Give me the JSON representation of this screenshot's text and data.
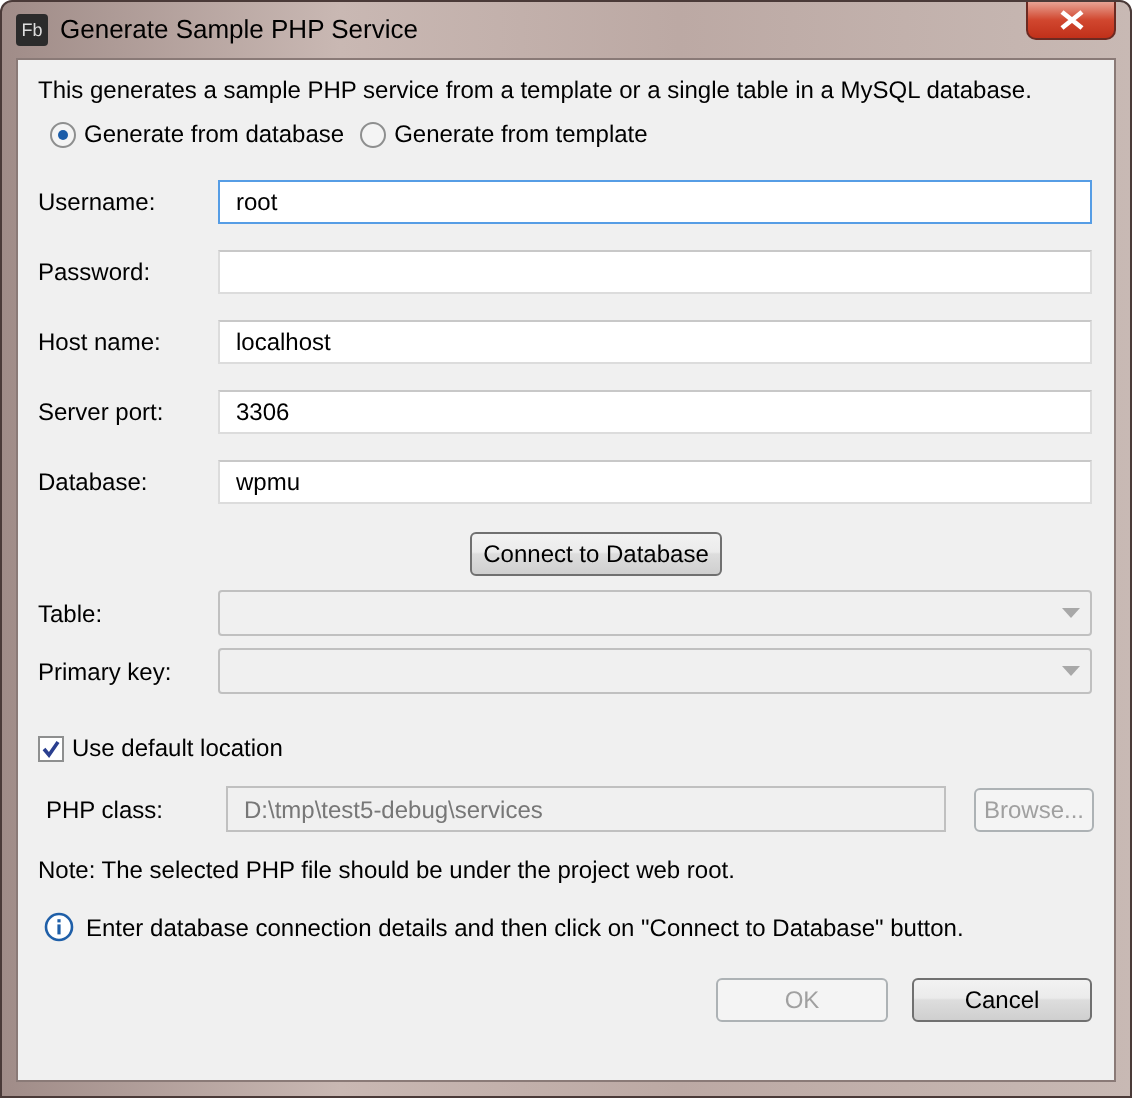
{
  "window": {
    "title": "Generate Sample PHP Service",
    "app_icon": "Fb"
  },
  "description": "This generates a sample PHP service from a template or a single table in a MySQL database.",
  "source_options": [
    {
      "label": "Generate from database",
      "selected": true
    },
    {
      "label": "Generate from template",
      "selected": false
    }
  ],
  "fields": [
    {
      "label": "Username:",
      "value": "root",
      "focused": true
    },
    {
      "label": "Password:",
      "focused": false
    },
    {
      "label": "Host name:",
      "value": "localhost",
      "focused": false
    },
    {
      "label": "Server port:",
      "value": "3306",
      "focused": false
    },
    {
      "label": "Database:",
      "value": "wpmu",
      "focused": false
    }
  ],
  "connect_button": "Connect to Database",
  "dropdowns": [
    {
      "label": "Table:",
      "disabled": true
    },
    {
      "label": "Primary key:",
      "disabled": true
    }
  ],
  "use_default_location": {
    "label": "Use default location",
    "checked": true
  },
  "php_class": {
    "label": "PHP class:",
    "value": "D:\\tmp\\test5-debug\\services",
    "disabled": true,
    "browse_button": {
      "label": "Browse...",
      "disabled": true
    }
  },
  "note": "Note: The selected PHP file should be under the project web root.",
  "info_message": "Enter database connection details and then click on \"Connect to Database\" button.",
  "buttons": [
    {
      "label": "OK",
      "disabled": true
    },
    {
      "label": "Cancel",
      "disabled": false
    }
  ]
}
